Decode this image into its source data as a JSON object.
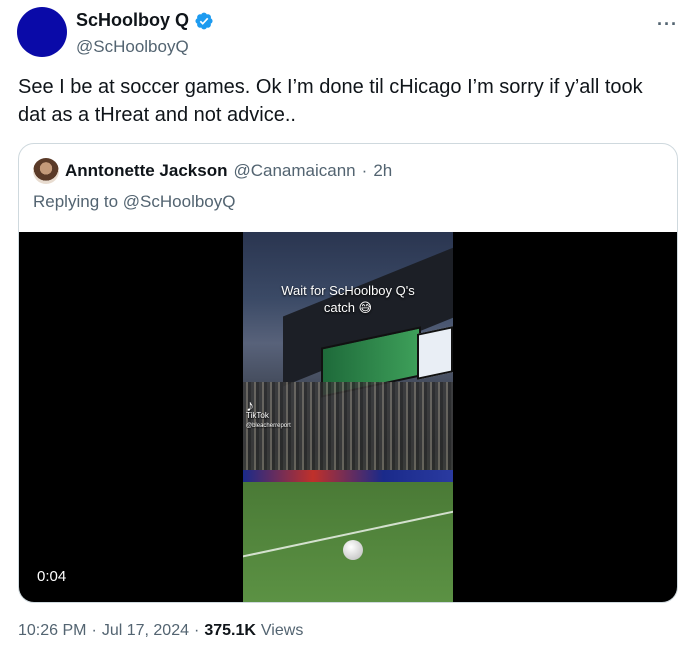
{
  "author": {
    "display_name": "ScHoolboy Q",
    "handle": "@ScHoolboyQ",
    "verified": true,
    "avatar_color": "#0a0aa8"
  },
  "more_label": "···",
  "tweet_text": "See I be at soccer games. Ok I’m done til cHicago I’m sorry if y’all took dat as a tHreat and not advice..",
  "quote": {
    "display_name": "Anntonette Jackson",
    "handle": "@Canamaicann",
    "separator": "·",
    "time": "2h",
    "replying_prefix": "Replying to",
    "replying_to": "@ScHoolboyQ"
  },
  "video": {
    "caption_line1": "Wait for ScHoolboy Q's",
    "caption_line2": "catch 😅",
    "watermark": "TikTok",
    "watermark_sub": "@bleacherreport",
    "time": "0:04"
  },
  "meta": {
    "time": "10:26 PM",
    "sep1": "·",
    "date": "Jul 17, 2024",
    "sep2": "·",
    "views_count": "375.1K",
    "views_label": "Views"
  },
  "colors": {
    "text_primary": "#0f1419",
    "text_secondary": "#536471",
    "border": "#cfd9de",
    "verified_blue": "#1d9bf0"
  },
  "icons": [
    "verified-badge-icon",
    "more-options-icon"
  ]
}
